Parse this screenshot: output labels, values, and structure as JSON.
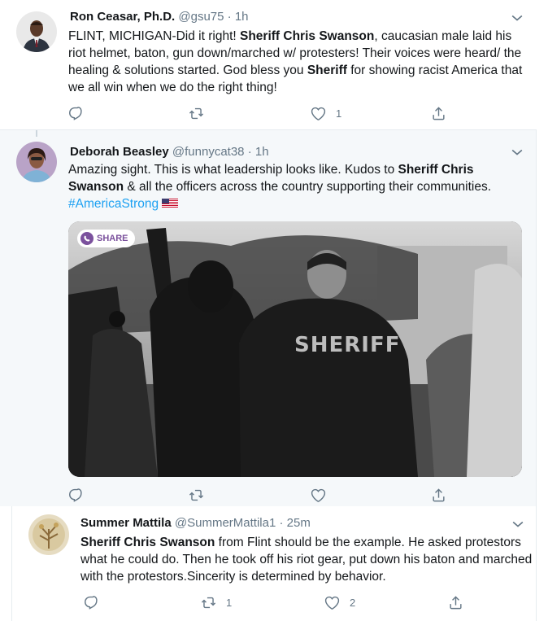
{
  "tweets": [
    {
      "name": "Ron Ceasar, Ph.D.",
      "handle": "@gsu75",
      "time": "· 1h",
      "text": [
        {
          "t": "FLINT, MICHIGAN-Did it right! "
        },
        {
          "t": "Sheriff Chris Swanson",
          "b": true
        },
        {
          "t": ", caucasian male laid his riot helmet, baton, gun down/marched w/ protesters!  Their voices were heard/ the healing & solutions started. God bless you "
        },
        {
          "t": "Sheriff",
          "b": true
        },
        {
          "t": " for showing racist America that we all win when we do the right thing!"
        }
      ],
      "actions": {
        "reply": "",
        "retweet": "",
        "like": "1",
        "share": ""
      }
    },
    {
      "name": "Deborah Beasley",
      "handle": "@funnycat38",
      "time": "· 1h",
      "text": [
        {
          "t": "Amazing sight. This is what leadership looks like. Kudos to "
        },
        {
          "t": "Sheriff Chris Swanson",
          "b": true
        },
        {
          "t": " & all the officers across the country supporting their communities. "
        },
        {
          "t": "#AmericaStrong",
          "tag": true
        }
      ],
      "media": {
        "badge": "SHARE",
        "jacket_text": "SHERIFF"
      },
      "actions": {
        "reply": "",
        "retweet": "",
        "like": "",
        "share": ""
      }
    },
    {
      "name": "Summer Mattila",
      "handle": "@SummerMattila1",
      "time": "· 25m",
      "text": [
        {
          "t": "Sheriff Chris Swanson",
          "b": true
        },
        {
          "t": " from Flint should be the example. He asked protestors what he could do. Then he took off his riot gear, put down his baton and marched with the protestors.Sincerity is determined by behavior."
        }
      ],
      "actions": {
        "reply": "",
        "retweet": "1",
        "like": "2",
        "share": ""
      }
    }
  ],
  "colors": {
    "text": "#14171a",
    "muted": "#657786",
    "link": "#1da1f2",
    "highlight_bg": "#f5f8fa",
    "viber": "#7b519d"
  }
}
